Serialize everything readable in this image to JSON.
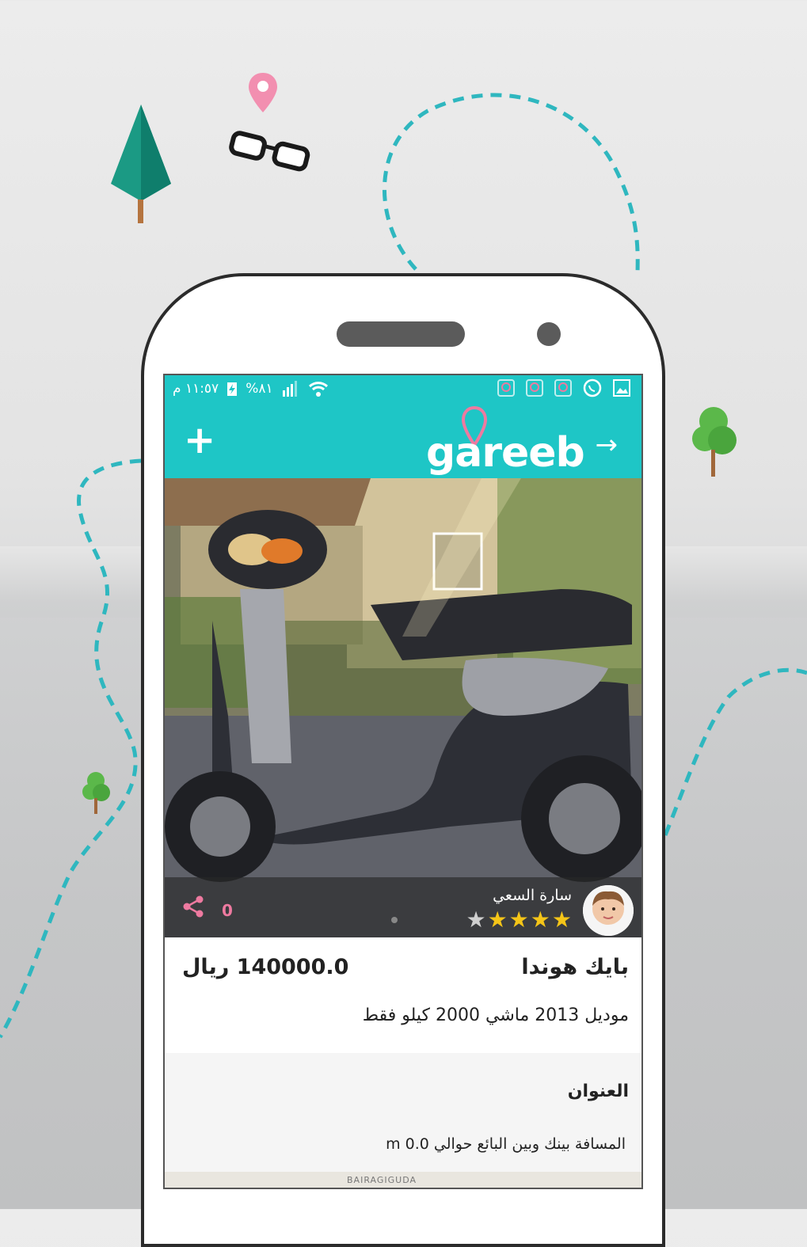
{
  "status_bar": {
    "time": "١١:٥٧ م",
    "battery": "%٨١"
  },
  "app_bar": {
    "logo_text": "gareeb",
    "add_label": "+",
    "back_arrow": "→"
  },
  "listing": {
    "seller_name": "سارة السعي",
    "rating_filled": 4,
    "rating_total": 5,
    "share_count": "0",
    "title": "بايك هوندا",
    "price": "140000.0 ريال",
    "description": "موديل 2013 ماشي 2000 كيلو فقط",
    "address_label": "العنوان",
    "distance_text": "المسافة بينك وبين البائع حوالي 0.0 m",
    "map_label": "BAIRAGIGUDA"
  },
  "colors": {
    "accent": "#1ec6c6",
    "pink": "#ee7aa0",
    "star": "#f5c518"
  }
}
